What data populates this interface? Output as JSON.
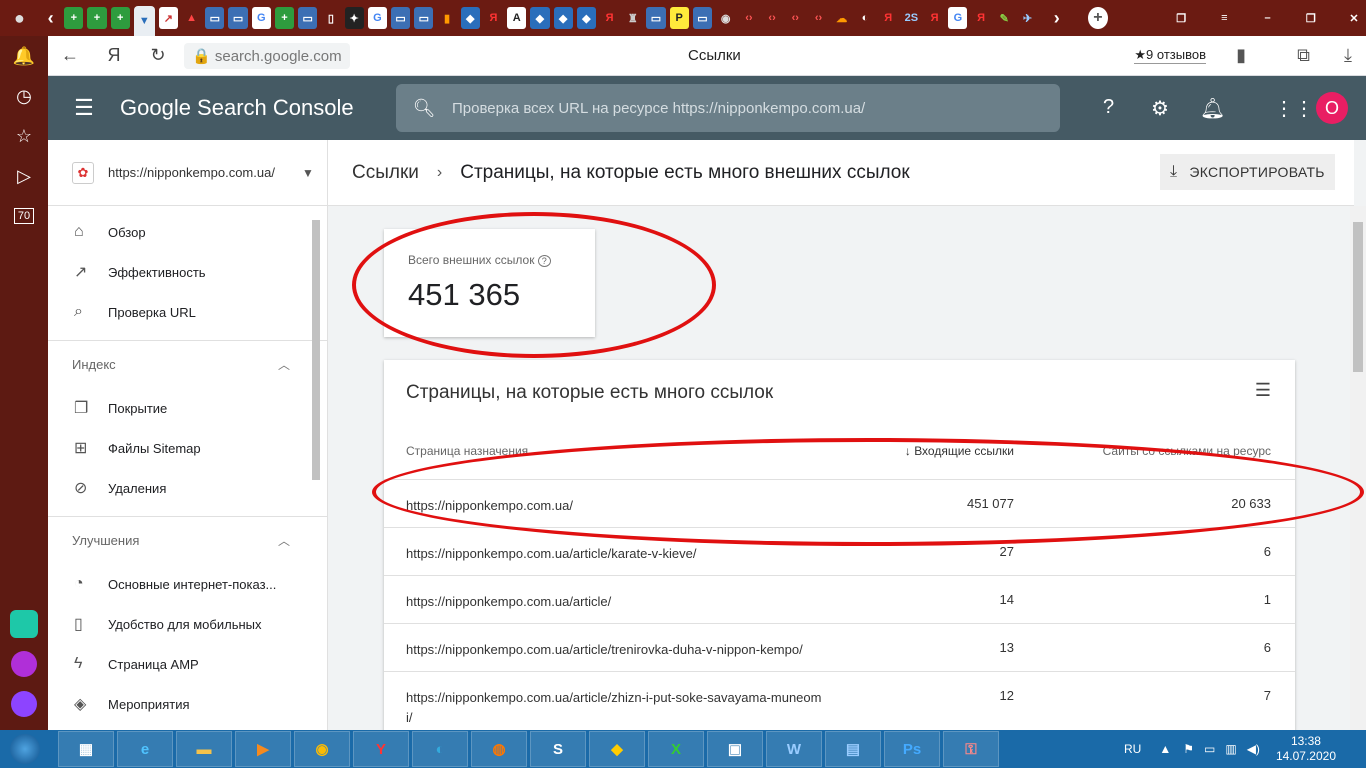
{
  "browser": {
    "url": "search.google.com",
    "title": "Ссылки",
    "reviews": "★9 отзывов",
    "side_badge": "70"
  },
  "gsc": {
    "logo": "Google Search Console",
    "search_placeholder": "Проверка всех URL на ресурсе https://nipponkempo.com.ua/",
    "avatar_letter": "O",
    "property": "https://nipponkempo.com.ua/"
  },
  "nav": {
    "overview": "Обзор",
    "performance": "Эффективность",
    "url_inspection": "Проверка URL",
    "index_section": "Индекс",
    "coverage": "Покрытие",
    "sitemaps": "Файлы Sitemap",
    "removals": "Удаления",
    "enhancements_section": "Улучшения",
    "core_web_vitals": "Основные интернет-показ...",
    "mobile_usability": "Удобство для мобильных",
    "amp": "Страница AMP",
    "events": "Мероприятия"
  },
  "main": {
    "breadcrumb_parent": "Ссылки",
    "breadcrumb_current": "Страницы, на которые есть много внешних ссылок",
    "export_label": "ЭКСПОРТИРОВАТЬ",
    "total_label": "Всего внешних ссылок",
    "total_value": "451 365",
    "table_title": "Страницы, на которые есть много ссылок",
    "columns": [
      "Страница назначения",
      "Входящие ссылки",
      "Сайты со ссылками на ресурс"
    ],
    "rows": [
      {
        "page": "https://nipponkempo.com.ua/",
        "incoming": "451 077",
        "sites": "20 633"
      },
      {
        "page": "https://nipponkempo.com.ua/article/karate-v-kieve/",
        "incoming": "27",
        "sites": "6"
      },
      {
        "page": "https://nipponkempo.com.ua/article/",
        "incoming": "14",
        "sites": "1"
      },
      {
        "page": "https://nipponkempo.com.ua/article/trenirovka-duha-v-nippon-kempo/",
        "incoming": "13",
        "sites": "6"
      },
      {
        "page": "https://nipponkempo.com.ua/article/zhizn-i-put-soke-savayama-muneomi/",
        "incoming": "12",
        "sites": "7"
      }
    ]
  },
  "taskbar": {
    "lang": "RU",
    "time": "13:38",
    "date": "14.07.2020"
  },
  "colors": {
    "gsc_header": "#455a64",
    "annotation": "#e01010",
    "avatar": "#e91e63"
  }
}
